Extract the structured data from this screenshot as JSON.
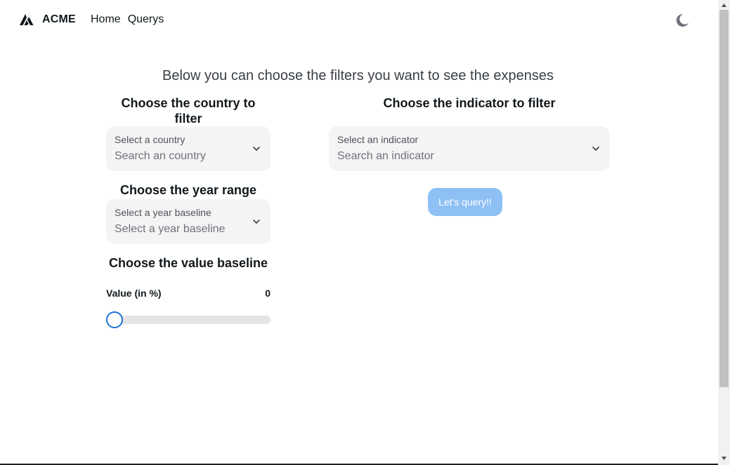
{
  "nav": {
    "brand": "ACME",
    "links": [
      "Home",
      "Querys"
    ],
    "theme_icon": "moon-icon"
  },
  "main": {
    "subtitle": "Below you can choose the filters you want to see the expenses",
    "country": {
      "title": "Choose the country to filter",
      "label": "Select a country",
      "placeholder": "Search an country"
    },
    "indicator": {
      "title": "Choose the indicator to filter",
      "label": "Select an indicator",
      "placeholder": "Search an indicator"
    },
    "year": {
      "title": "Choose the year range",
      "label": "Select a year baseline",
      "placeholder": "Select a year baseline"
    },
    "value": {
      "title": "Choose the value baseline",
      "label": "Value (in %)",
      "current": "0",
      "percent": 0
    },
    "query_button": "Let's query!!"
  },
  "colors": {
    "button": "#8ec0f5",
    "slider_border": "#1a72d8",
    "select_bg": "#f4f4f5"
  }
}
